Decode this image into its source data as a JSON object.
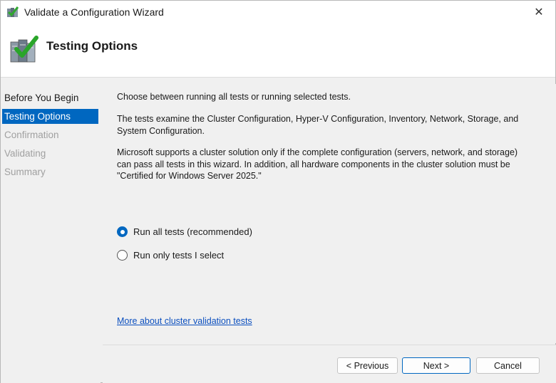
{
  "window": {
    "title": "Validate a Configuration Wizard",
    "close_glyph": "✕"
  },
  "header": {
    "title": "Testing Options",
    "icon": "cluster-validate-checkmark-icon"
  },
  "nav": {
    "items": [
      {
        "label": "Before You Begin",
        "state": "normal"
      },
      {
        "label": "Testing Options",
        "state": "active"
      },
      {
        "label": "Confirmation",
        "state": "disabled"
      },
      {
        "label": "Validating",
        "state": "disabled"
      },
      {
        "label": "Summary",
        "state": "disabled"
      }
    ]
  },
  "content": {
    "intro": "Choose between running all tests or running selected tests.",
    "tests_desc": "The tests examine the Cluster Configuration, Hyper-V Configuration, Inventory, Network, Storage, and System Configuration.",
    "support_desc": "Microsoft supports a cluster solution only if the complete configuration (servers, network, and storage) can pass all tests in this wizard. In addition, all hardware components in the cluster solution must be \"Certified for Windows Server 2025.\"",
    "options": [
      {
        "label": "Run all tests (recommended)",
        "checked": true
      },
      {
        "label": "Run only tests I select",
        "checked": false
      }
    ],
    "more_link": "More about cluster validation tests"
  },
  "footer": {
    "previous_label": "< Previous",
    "next_label": "Next >",
    "cancel_label": "Cancel"
  },
  "colors": {
    "accent": "#0067c0",
    "link": "#0b4fbf"
  }
}
